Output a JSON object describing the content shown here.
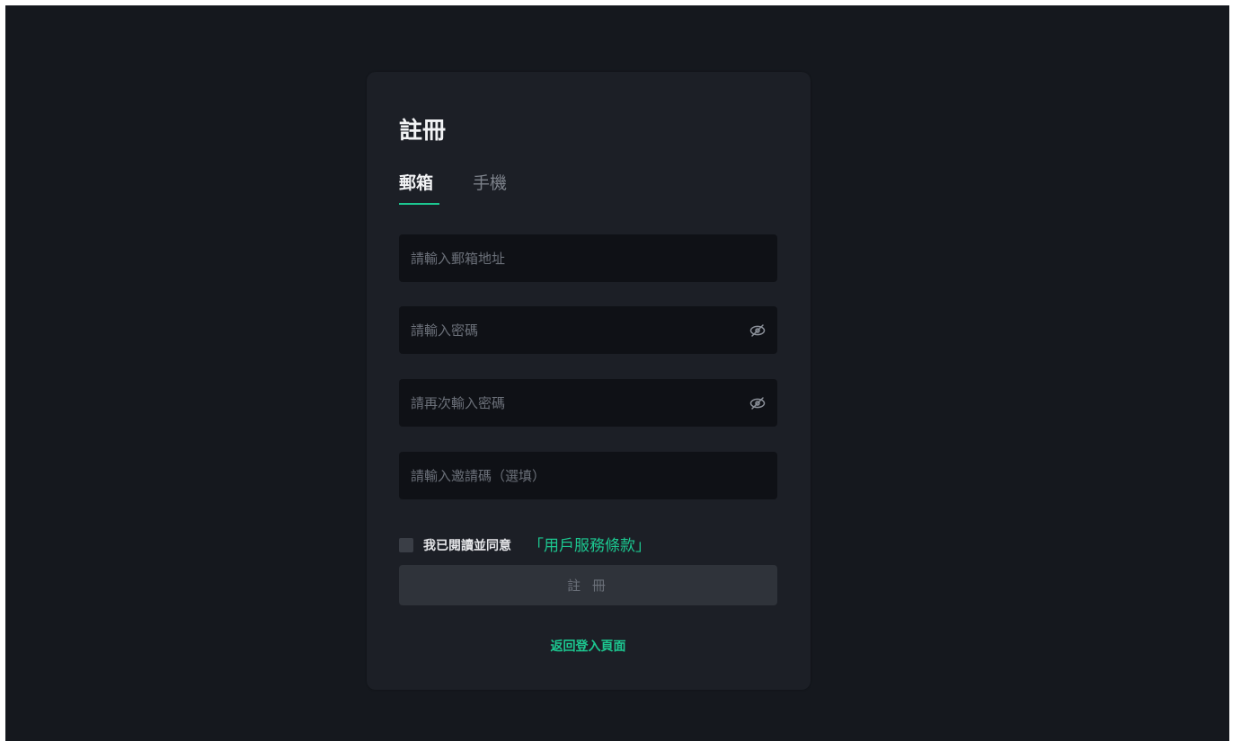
{
  "page": {
    "title": "註冊"
  },
  "tabs": [
    {
      "label": "郵箱",
      "active": true
    },
    {
      "label": "手機",
      "active": false
    }
  ],
  "form": {
    "email": {
      "value": "",
      "placeholder": "請輸入郵箱地址"
    },
    "password": {
      "value": "",
      "placeholder": "請輸入密碼",
      "toggle_icon": "eye-off-icon"
    },
    "confirm_password": {
      "value": "",
      "placeholder": "請再次輸入密碼",
      "toggle_icon": "eye-off-icon"
    },
    "invite_code": {
      "value": "",
      "placeholder": "請輸入邀請碼（選填）"
    }
  },
  "agreement": {
    "checked": false,
    "text": "我已閱讀並同意",
    "link": "「用戶服務條款」"
  },
  "submit_label": "註 冊",
  "back_link": "返回登入頁面",
  "colors": {
    "background": "#15181e",
    "card": "#1c1f26",
    "input": "#0f1116",
    "accent": "#1cc790",
    "button_disabled": "#2f333a"
  }
}
